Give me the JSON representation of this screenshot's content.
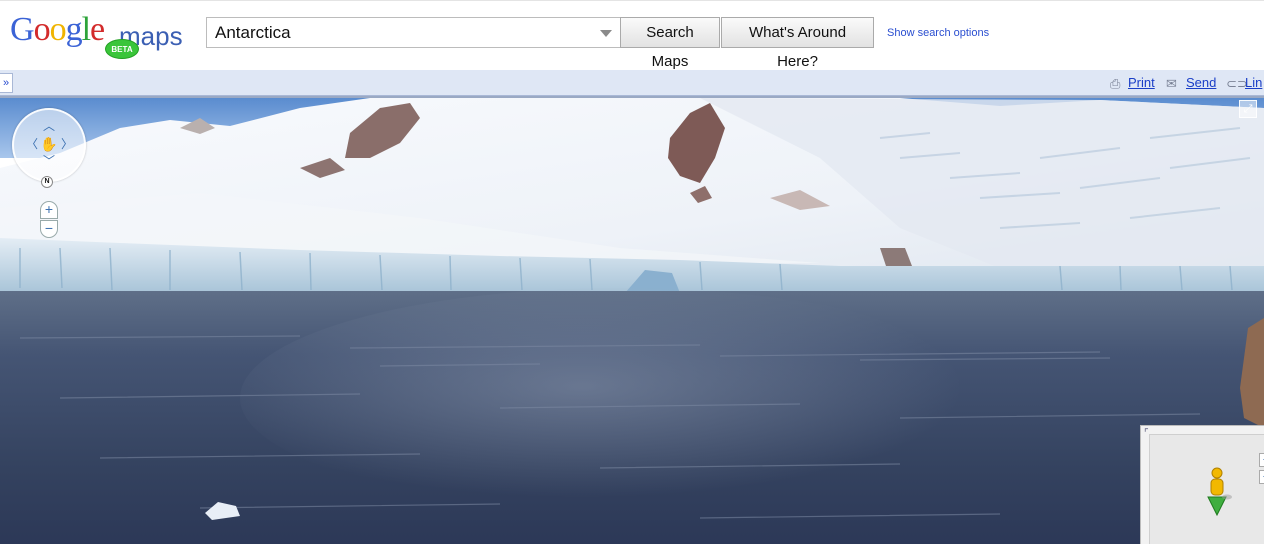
{
  "logo": {
    "word": "Google",
    "product": "maps",
    "badge": "BETA"
  },
  "search": {
    "value": "Antarctica",
    "search_label": "Search Maps",
    "around_label": "What's Around Here?",
    "options_label": "Show search options"
  },
  "toolbar": {
    "collapse": "»",
    "print": "Print",
    "send": "Send",
    "link": "Lin"
  },
  "streetview": {
    "north": "N",
    "zoom_in": "+",
    "zoom_out": "−"
  },
  "minimap": {
    "zoom_in": "+",
    "zoom_out": "−"
  },
  "colors": {
    "accent_link": "#1a3ec7",
    "toolbar_bg": "#dfe7f5",
    "beta_badge": "#3ac53a"
  },
  "icons": [
    "print-icon",
    "mail-icon",
    "link-icon",
    "hand-pan-icon",
    "fullscreen-icon",
    "pegman-icon",
    "dropdown-arrow-icon"
  ]
}
